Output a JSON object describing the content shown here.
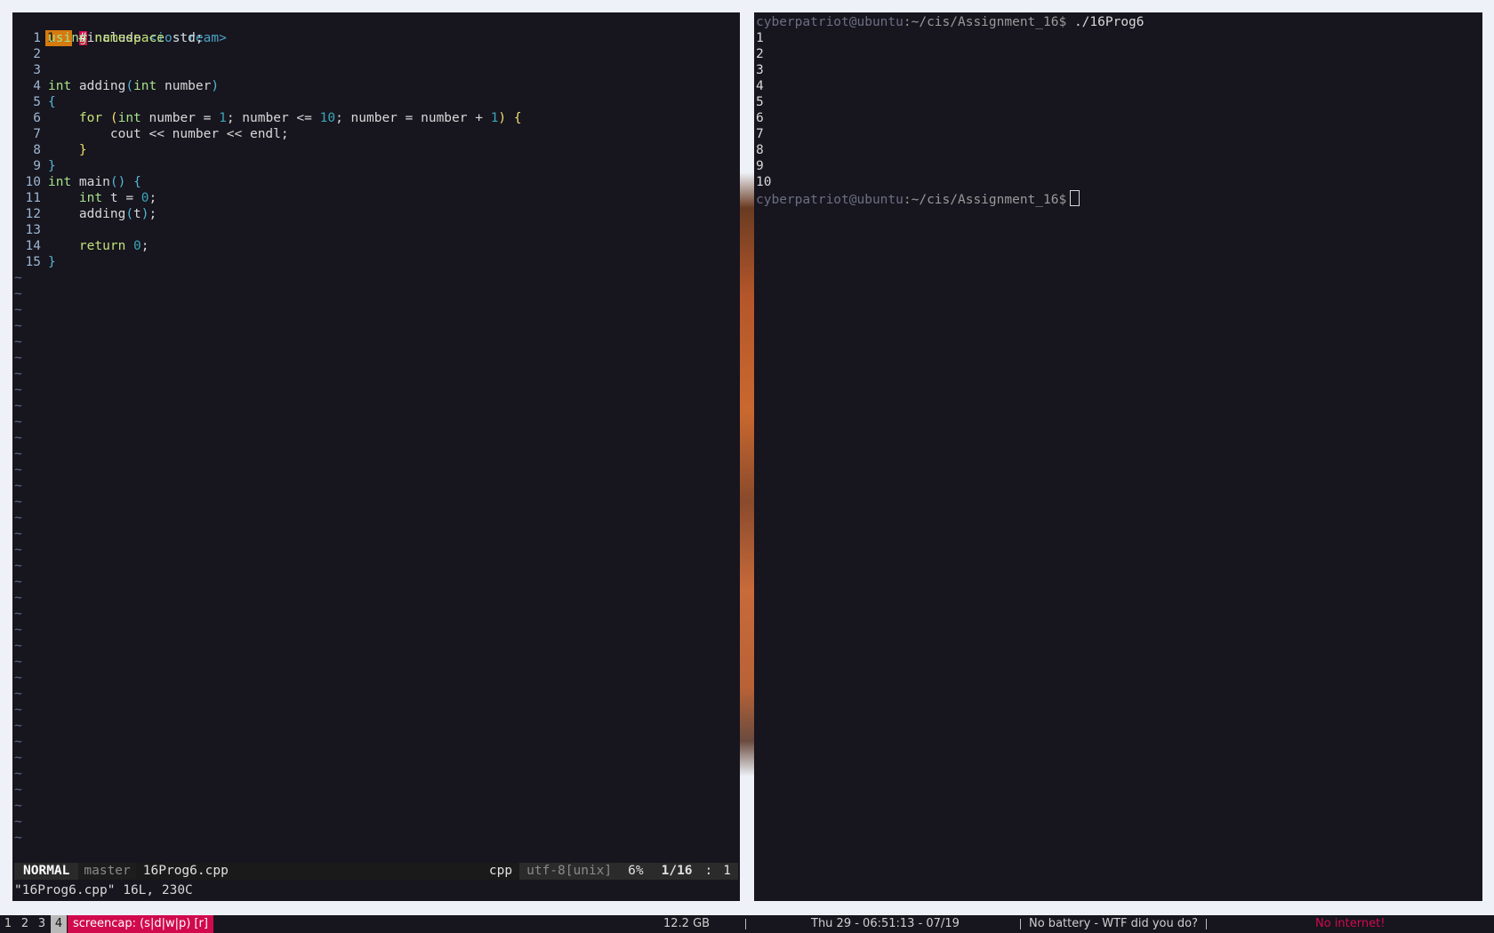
{
  "editor": {
    "first_line_num": "1",
    "lines": [
      {
        "num": "1",
        "segments": [
          [
            "type",
            "using"
          ],
          [
            "id",
            " "
          ],
          [
            "ns",
            "namespace"
          ],
          [
            "id",
            " std;"
          ]
        ]
      },
      {
        "num": "2",
        "segments": []
      },
      {
        "num": "3",
        "segments": []
      },
      {
        "num": "4",
        "segments": [
          [
            "type",
            "int"
          ],
          [
            "id",
            " adding"
          ],
          [
            "paren",
            "("
          ],
          [
            "type",
            "int"
          ],
          [
            "id",
            " number"
          ],
          [
            "paren",
            ")"
          ]
        ]
      },
      {
        "num": "5",
        "segments": [
          [
            "brace-blue",
            "{"
          ]
        ]
      },
      {
        "num": "6",
        "segments": [
          [
            "id",
            "    "
          ],
          [
            "kw",
            "for"
          ],
          [
            "id",
            " "
          ],
          [
            "brace",
            "("
          ],
          [
            "type",
            "int"
          ],
          [
            "id",
            " number = "
          ],
          [
            "num",
            "1"
          ],
          [
            "id",
            "; number <= "
          ],
          [
            "num",
            "10"
          ],
          [
            "id",
            "; number = number + "
          ],
          [
            "num",
            "1"
          ],
          [
            "brace",
            ")"
          ],
          [
            "id",
            " "
          ],
          [
            "brace",
            "{"
          ]
        ]
      },
      {
        "num": "7",
        "segments": [
          [
            "id",
            "        cout << number << endl;"
          ]
        ]
      },
      {
        "num": "8",
        "segments": [
          [
            "id",
            "    "
          ],
          [
            "brace",
            "}"
          ]
        ]
      },
      {
        "num": "9",
        "segments": [
          [
            "brace-blue",
            "}"
          ]
        ]
      },
      {
        "num": "10",
        "segments": [
          [
            "type",
            "int"
          ],
          [
            "id",
            " main"
          ],
          [
            "paren",
            "()"
          ],
          [
            "id",
            " "
          ],
          [
            "brace-blue",
            "{"
          ]
        ]
      },
      {
        "num": "11",
        "segments": [
          [
            "id",
            "    "
          ],
          [
            "type",
            "int"
          ],
          [
            "id",
            " t = "
          ],
          [
            "num",
            "0"
          ],
          [
            "id",
            ";"
          ]
        ]
      },
      {
        "num": "12",
        "segments": [
          [
            "id",
            "    adding"
          ],
          [
            "paren",
            "("
          ],
          [
            "id",
            "t"
          ],
          [
            "paren",
            ")"
          ],
          [
            "id",
            ";"
          ]
        ]
      },
      {
        "num": "13",
        "segments": []
      },
      {
        "num": "14",
        "segments": [
          [
            "id",
            "    "
          ],
          [
            "kw",
            "return"
          ],
          [
            "id",
            " "
          ],
          [
            "num",
            "0"
          ],
          [
            "id",
            ";"
          ]
        ]
      },
      {
        "num": "15",
        "segments": [
          [
            "brace-blue",
            "}"
          ]
        ]
      }
    ],
    "include_hash": "#",
    "include_kw": "include",
    "include_header": "<iostream>",
    "tilde": "~",
    "tilde_count": 36,
    "statusline": {
      "mode": "NORMAL",
      "branch": " master",
      "file": "16Prog6.cpp",
      "filetype": "cpp",
      "encoding": "utf-8[unix]",
      "percent": "6% ",
      "position": "1/16 ",
      "col_sep": ":",
      "col": "1"
    },
    "cmdline": "\"16Prog6.cpp\" 16L, 230C"
  },
  "terminal": {
    "user_host": "cyberpatriot@ubuntu",
    "path": ":~/cis/Assignment_16",
    "dollar": "$",
    "command": " ./16Prog6",
    "output": [
      "1",
      "2",
      "3",
      "4",
      "5",
      "6",
      "7",
      "8",
      "9",
      "10"
    ]
  },
  "bar": {
    "workspaces": [
      "1",
      "2",
      "3",
      "4"
    ],
    "active_workspace": "4",
    "mode": "screencap: (s|d|w|p) [r]",
    "disk": "12.2 GB",
    "datetime": "Thu 29 - 06:51:13 - 07/19",
    "battery": "No battery - WTF did you do?",
    "network": "No internet!"
  },
  "colors": {
    "pane_bg": "#17151e",
    "accent_red": "#d10a4e",
    "cursorline_orange": "#d67a0f"
  }
}
